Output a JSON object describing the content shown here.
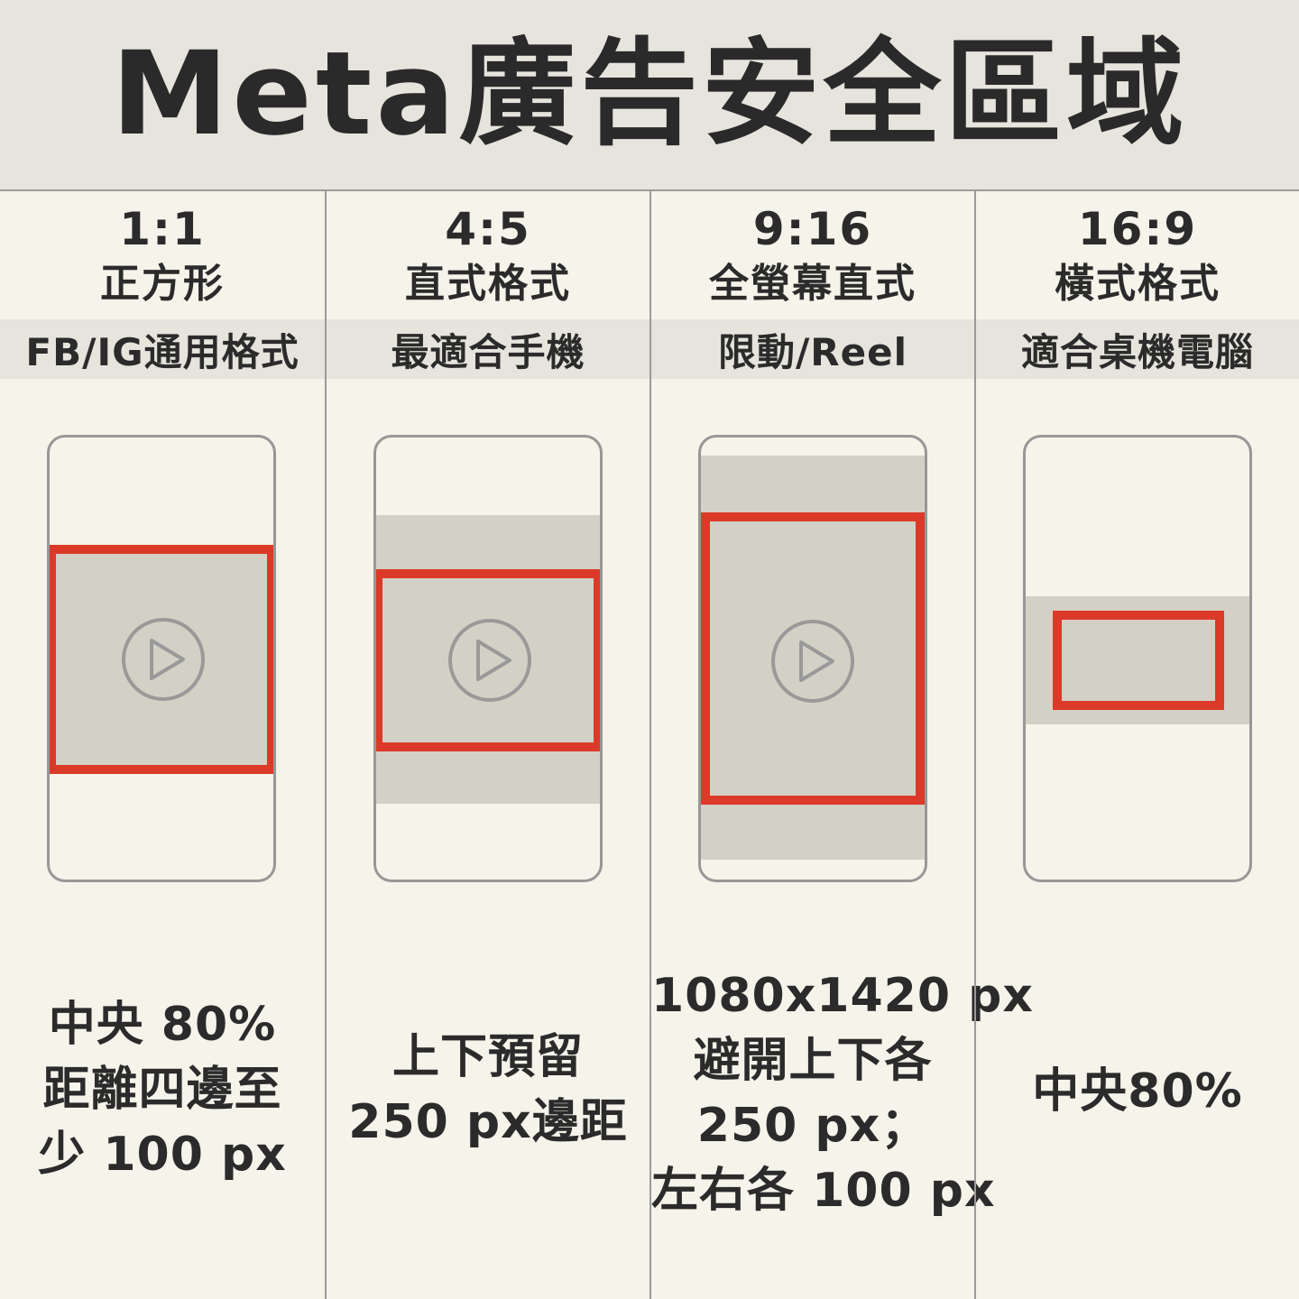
{
  "title": "Meta廣告安全區域",
  "colors": {
    "background": "#f5f3ea",
    "band": "#e6e4dc",
    "content_area": "#d3d0c6",
    "safe_zone": "#dc3a28",
    "outline": "#979797",
    "text": "#2b2b2b"
  },
  "columns": [
    {
      "ratio": "1:1",
      "name": "正方形",
      "usage": "FB/IG通用格式",
      "icon": "play-icon",
      "note_lines": [
        "中央 80%",
        "距離四邊至",
        "少 100 px"
      ]
    },
    {
      "ratio": "4:5",
      "name": "直式格式",
      "usage": "最適合手機",
      "icon": "play-icon",
      "note_lines": [
        "上下預留",
        "250 px邊距"
      ]
    },
    {
      "ratio": "9:16",
      "name": "全螢幕直式",
      "usage": "限動/Reel",
      "icon": "play-icon",
      "note_lines": [
        "1080x1420 px",
        "避開上下各",
        "250 px；",
        "左右各 100 px"
      ]
    },
    {
      "ratio": "16:9",
      "name": "橫式格式",
      "usage": "適合桌機電腦",
      "note_lines": [
        "中央80%"
      ]
    }
  ]
}
